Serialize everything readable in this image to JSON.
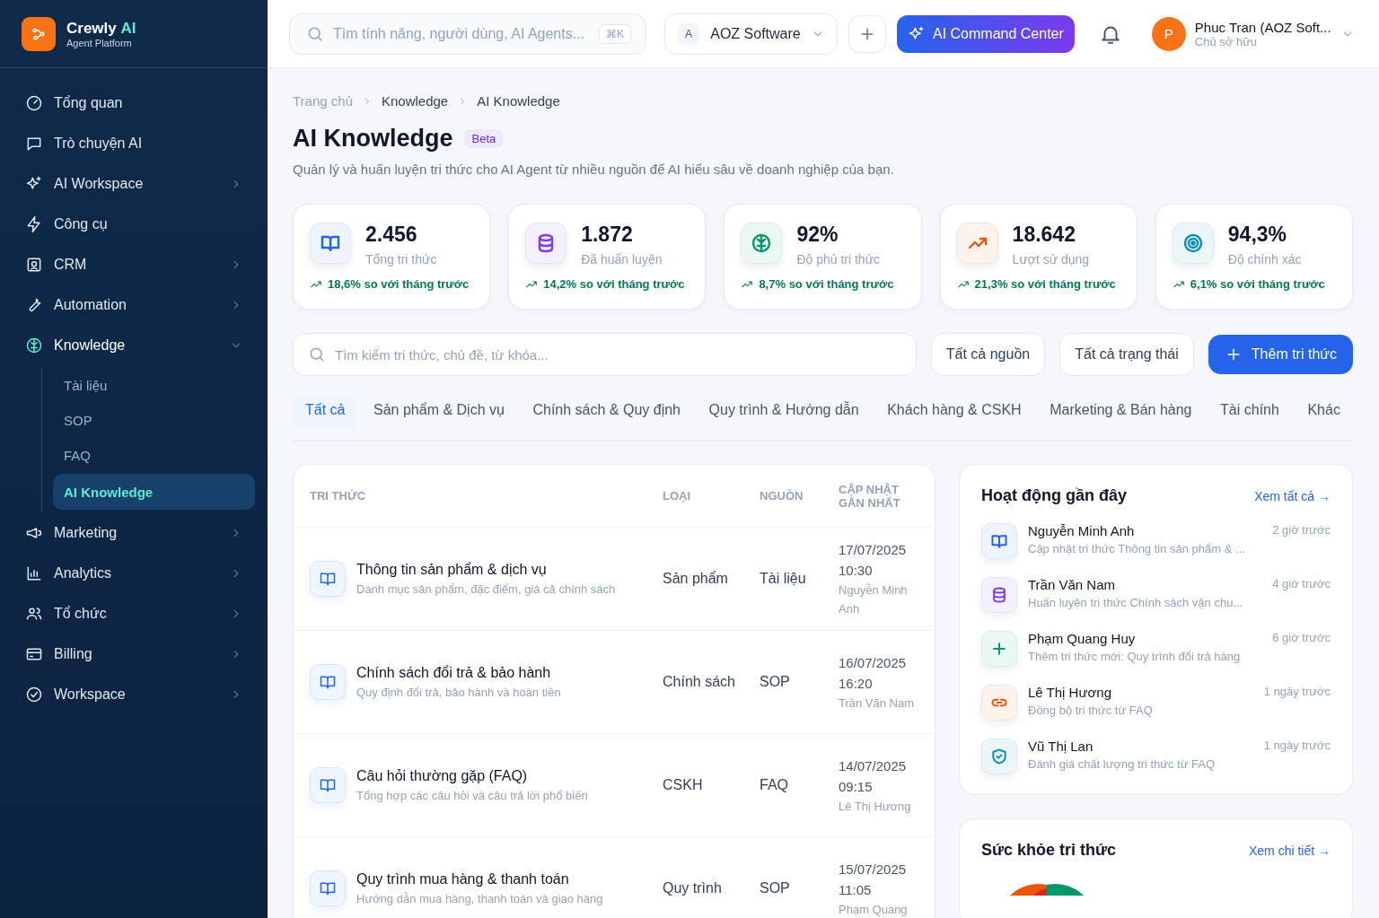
{
  "brand": {
    "name": "Crewly",
    "accent": "AI",
    "subtitle": "Agent Platform"
  },
  "sidebar": {
    "items": [
      {
        "label": "Tổng quan",
        "kind": "link"
      },
      {
        "label": "Trò chuyện AI",
        "kind": "link"
      },
      {
        "label": "AI Workspace",
        "kind": "group",
        "expanded": false
      },
      {
        "label": "Công cụ",
        "kind": "link"
      },
      {
        "label": "CRM",
        "kind": "group",
        "expanded": false
      },
      {
        "label": "Automation",
        "kind": "group",
        "expanded": false
      },
      {
        "label": "Knowledge",
        "kind": "group",
        "expanded": true,
        "children": [
          {
            "label": "Tài liệu",
            "selected": false
          },
          {
            "label": "SOP",
            "selected": false
          },
          {
            "label": "FAQ",
            "selected": false
          },
          {
            "label": "AI Knowledge",
            "selected": true
          }
        ]
      },
      {
        "label": "Marketing",
        "kind": "group",
        "expanded": false
      },
      {
        "label": "Analytics",
        "kind": "group",
        "expanded": false
      },
      {
        "label": "Tổ chức",
        "kind": "group",
        "expanded": false
      },
      {
        "label": "Billing",
        "kind": "group",
        "expanded": false
      },
      {
        "label": "Workspace",
        "kind": "group",
        "expanded": false
      }
    ]
  },
  "header": {
    "search": {
      "placeholder": "Tìm tính năng, người dùng, AI Agents...",
      "shortcut": "⌘K"
    },
    "org": {
      "initial": "A",
      "name": "AOZ Software"
    },
    "command_button": "AI Command Center",
    "user": {
      "initial": "P",
      "name": "Phuc Tran (AOZ Soft...",
      "role": "Chủ sở hữu"
    }
  },
  "breadcrumb": [
    "Trang chủ",
    "Knowledge",
    "AI Knowledge"
  ],
  "page": {
    "title": "AI Knowledge",
    "badge": "Beta",
    "description": "Quản lý và huấn luyện tri thức cho AI Agent từ nhiều nguồn để AI hiểu sâu về doanh nghiệp của bạn."
  },
  "stats": [
    {
      "value": "2.456",
      "label": "Tổng tri thức",
      "change": "18,6% so với tháng trước",
      "color": "#2563eb"
    },
    {
      "value": "1.872",
      "label": "Đã huấn luyện",
      "change": "14,2% so với tháng trước",
      "color": "#7c3aed"
    },
    {
      "value": "92%",
      "label": "Độ phủ tri thức",
      "change": "8,7% so với tháng trước",
      "color": "#059669"
    },
    {
      "value": "18.642",
      "label": "Lượt sử dụng",
      "change": "21,3% so với tháng trước",
      "color": "#ea580c"
    },
    {
      "value": "94,3%",
      "label": "Độ chính xác",
      "change": "6,1% so với tháng trước",
      "color": "#0891b2"
    }
  ],
  "filters": {
    "search": {
      "placeholder": "Tìm kiếm tri thức, chủ đề, từ khóa..."
    },
    "dropdowns": [
      "Tất cả nguồn",
      "Tất cả trạng thái"
    ],
    "add_button": "Thêm tri thức"
  },
  "tabs": [
    {
      "label": "Tất cả",
      "selected": true
    },
    {
      "label": "Sản phẩm & Dịch vụ",
      "selected": false
    },
    {
      "label": "Chính sách & Quy định",
      "selected": false
    },
    {
      "label": "Quy trình & Hướng dẫn",
      "selected": false
    },
    {
      "label": "Khách hàng & CSKH",
      "selected": false
    },
    {
      "label": "Marketing & Bán hàng",
      "selected": false
    },
    {
      "label": "Tài chính",
      "selected": false
    },
    {
      "label": "Khác",
      "selected": false
    }
  ],
  "table": {
    "columns": [
      "TRI THỨC",
      "LOẠI",
      "NGUỒN",
      "CẬP NHẬT GẦN NHẤT"
    ],
    "rows": [
      {
        "title": "Thông tin sản phẩm & dịch vụ",
        "description": "Danh mục sản phẩm, đặc điểm, giá cả chính sách",
        "type": "Sản phẩm",
        "source": "Tài liệu",
        "date": "17/07/2025",
        "time": "10:30",
        "author": "Nguyễn Minh Anh"
      },
      {
        "title": "Chính sách đổi trả & bảo hành",
        "description": "Quy định đổi trả, bảo hành và hoàn tiền",
        "type": "Chính sách",
        "source": "SOP",
        "date": "16/07/2025",
        "time": "16:20",
        "author": "Trần Văn Nam"
      },
      {
        "title": "Câu hỏi thường gặp (FAQ)",
        "description": "Tổng hợp các câu hỏi và câu trả lời phổ biến",
        "type": "CSKH",
        "source": "FAQ",
        "date": "14/07/2025",
        "time": "09:15",
        "author": "Lê Thị Hương"
      },
      {
        "title": "Quy trình mua hàng & thanh toán",
        "description": "Hướng dẫn mua hàng, thanh toán và giao hàng",
        "type": "Quy trình",
        "source": "SOP",
        "date": "15/07/2025",
        "time": "11:05",
        "author": "Phạm Quang"
      }
    ]
  },
  "activity": {
    "title": "Hoạt động gần đây",
    "link": "Xem tất cả →",
    "items": [
      {
        "name": "Nguyễn Minh Anh",
        "action": "Cập nhật tri thức Thông tin sản phẩm & ...",
        "time": "2 giờ trước",
        "color": "#2563eb"
      },
      {
        "name": "Trần Văn Nam",
        "action": "Huấn luyện tri thức Chính sách vận chu...",
        "time": "4 giờ trước",
        "color": "#7c3aed"
      },
      {
        "name": "Phạm Quang Huy",
        "action": "Thêm tri thức mới: Quy trình đổi trả hàng",
        "time": "6 giờ trước",
        "color": "#059669"
      },
      {
        "name": "Lê Thị Hương",
        "action": "Đồng bộ tri thức từ FAQ",
        "time": "1 ngày trước",
        "color": "#ea580c"
      },
      {
        "name": "Vũ Thị Lan",
        "action": "Đánh giá chất lượng tri thức từ FAQ",
        "time": "1 ngày trước",
        "color": "#0891b2"
      }
    ]
  },
  "health": {
    "title": "Sức khỏe tri thức",
    "link": "Xem chi tiết →"
  }
}
